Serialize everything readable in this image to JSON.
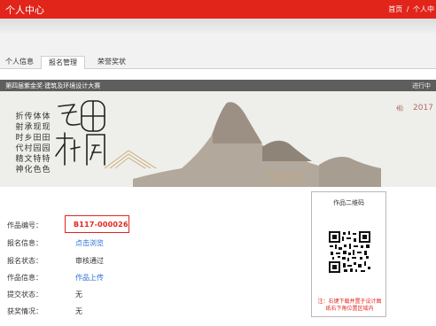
{
  "topbar": {
    "title": "个人中心",
    "crumb_home": "首页",
    "crumb_sep": "/",
    "crumb_current": "个人中"
  },
  "tabs": [
    {
      "label": "个人信息",
      "active": false
    },
    {
      "label": "报名管理",
      "active": true
    },
    {
      "label": "荣誉奖状",
      "active": false
    }
  ],
  "banner": {
    "competition_name": "第四届紫金奖·建筑及环境设计大赛",
    "status": "进行中",
    "slogan": [
      "折",
      "传",
      "体",
      "体",
      "射",
      "承",
      "现",
      "现",
      "时",
      "乡",
      "田",
      "田",
      "代",
      "村",
      "园",
      "园",
      "精",
      "文",
      "特",
      "特",
      "神",
      "化",
      "色",
      "色"
    ],
    "calligraphy": [
      "乡",
      "田",
      "村",
      "园"
    ],
    "year": "2017"
  },
  "info": {
    "rows": [
      {
        "label": "作品编号：",
        "value": "B117-000026"
      },
      {
        "label": "报名信息：",
        "value": "点击浏览"
      },
      {
        "label": "报名状态：",
        "value": "审核通过"
      },
      {
        "label": "作品信息：",
        "value": "作品上传"
      },
      {
        "label": "提交状态：",
        "value": "无"
      },
      {
        "label": "获奖情况：",
        "value": "无"
      }
    ]
  },
  "qr": {
    "title": "作品二维码",
    "note": "注：右键下载并置于设计图纸右下角位置区域内"
  },
  "colors": {
    "brand_red": "#e1251b",
    "link_blue": "#2a6fd6",
    "banner_dark": "#5e5e5e",
    "mountain": "#a79b8e",
    "gold": "#c9a46a"
  }
}
